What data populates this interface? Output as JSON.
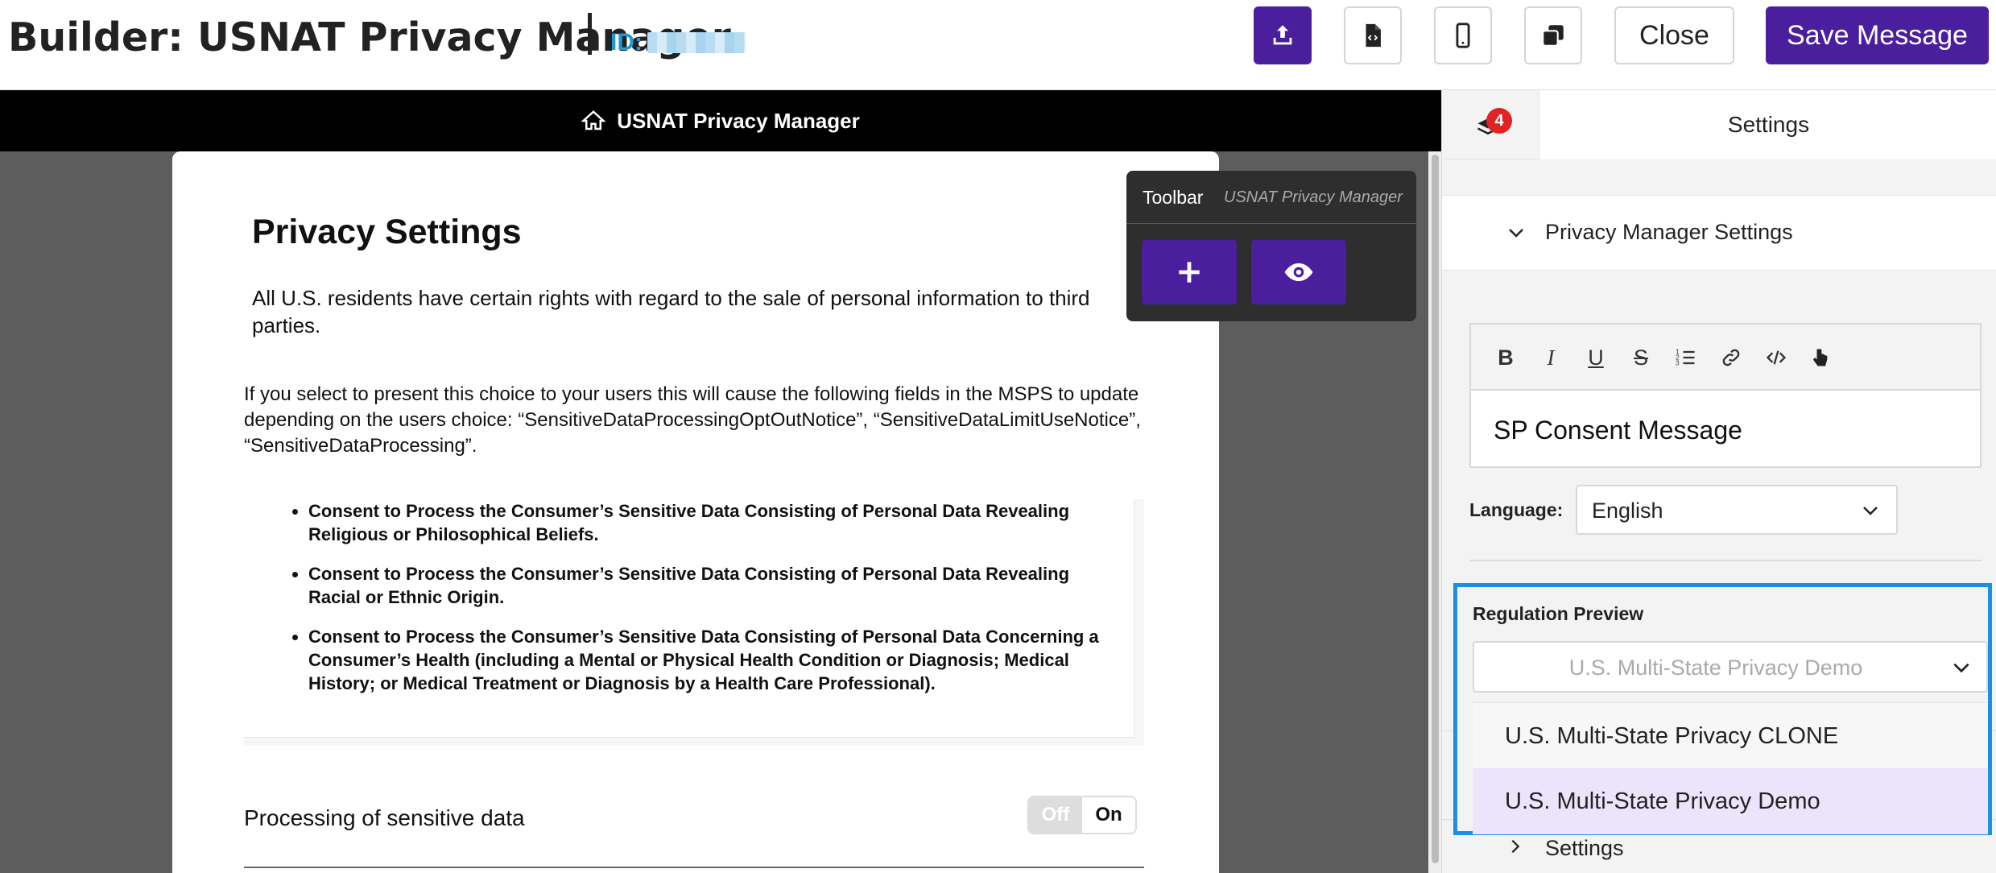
{
  "header": {
    "title": "Builder: USNAT Privacy Manager",
    "id_label": "ID:",
    "close_label": "Close",
    "save_label": "Save Message",
    "icons": [
      "upload-icon",
      "code-file-icon",
      "mobile-icon",
      "copy-icon"
    ]
  },
  "canvas": {
    "bar_title": "USNAT Privacy Manager",
    "modal": {
      "title": "Privacy Settings",
      "intro": "All U.S. residents have certain rights with regard to the sale of personal information to third parties.",
      "description": "If you select to present this choice to your users this will cause the following fields in the MSPS to update depending on the users choice: “SensitiveDataProcessingOptOutNotice”, “SensitiveDataLimitUseNotice”, “SensitiveDataProcessing”.",
      "items": [
        "Consent to Process the Consumer’s Sensitive Data Consisting of Personal Data Revealing Religious or Philosophical Beliefs.",
        "Consent to Process the Consumer’s Sensitive Data Consisting of Personal Data Revealing Racial or Ethnic Origin.",
        "Consent to Process the Consumer’s Sensitive Data Consisting of Personal Data Concerning a Consumer’s Health (including a Mental or Physical Health Condition or Diagnosis; Medical History; or Medical Treatment or Diagnosis by a Health Care Professional)."
      ],
      "toggle_label": "Processing of sensitive data",
      "toggle_off": "Off",
      "toggle_on": "On"
    },
    "toolbar": {
      "title": "Toolbar",
      "subtitle": "USNAT Privacy Manager"
    }
  },
  "panel": {
    "badge_count": "4",
    "tab_label": "Settings",
    "section_label": "Privacy Manager Settings",
    "editor_text": "SP Consent Message",
    "language_label": "Language:",
    "language_value": "English",
    "regulation_label": "Regulation Preview",
    "regulation_value": "U.S. Multi-State Privacy Demo",
    "regulation_options": [
      "U.S. Multi-State Privacy CLONE",
      "U.S. Multi-State Privacy Demo"
    ],
    "settings_label": "Settings"
  },
  "colors": {
    "brand": "#4b1e9e",
    "accent_blue": "#1a8fe3",
    "badge": "#e02424",
    "selected_option": "#ebe4fb"
  }
}
